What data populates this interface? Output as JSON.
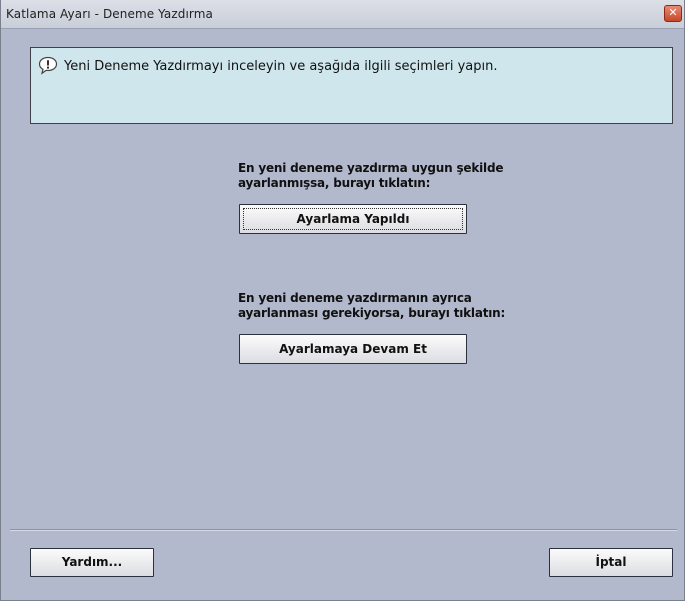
{
  "window": {
    "title": "Katlama Ayarı - Deneme Yazdırma",
    "close_label": "✕"
  },
  "message": {
    "icon": "speech-bubble-exclamation-icon",
    "text": "Yeni Deneme Yazdırmayı inceleyin ve aşağıda ilgili seçimleri yapın."
  },
  "option1": {
    "line1": "En yeni deneme yazdırma uygun şekilde",
    "line2": "ayarlanmışsa, burayı tıklatın:",
    "button_label": "Ayarlama Yapıldı"
  },
  "option2": {
    "line1": "En yeni deneme yazdırmanın ayrıca",
    "line2": "ayarlanması gerekiyorsa, burayı tıklatın:",
    "button_label": "Ayarlamaya Devam Et"
  },
  "footer": {
    "help_label": "Yardım...",
    "cancel_label": "İptal"
  }
}
